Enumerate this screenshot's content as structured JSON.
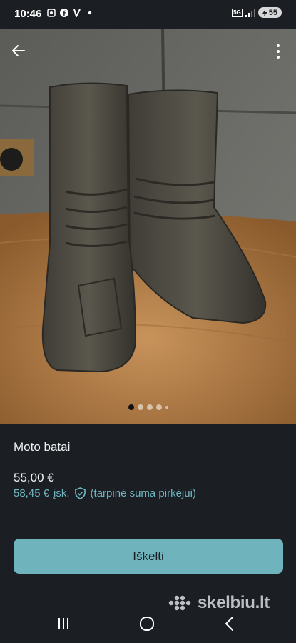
{
  "status_bar": {
    "time": "10:46",
    "network": "5G",
    "battery": "55"
  },
  "gallery": {
    "image_count": 5,
    "active_index": 0
  },
  "listing": {
    "title": "Moto batai",
    "price": "55,00 €",
    "buyer_price": "58,45 €",
    "buyer_price_suffix": "įsk.",
    "buyer_price_note": "(tarpinė suma pirkėjui)"
  },
  "actions": {
    "buy_label": "Iškelti"
  },
  "brand": {
    "logo_text": "skelbiu.lt"
  },
  "colors": {
    "accent": "#6fb3bd",
    "background": "#1b1f24"
  }
}
